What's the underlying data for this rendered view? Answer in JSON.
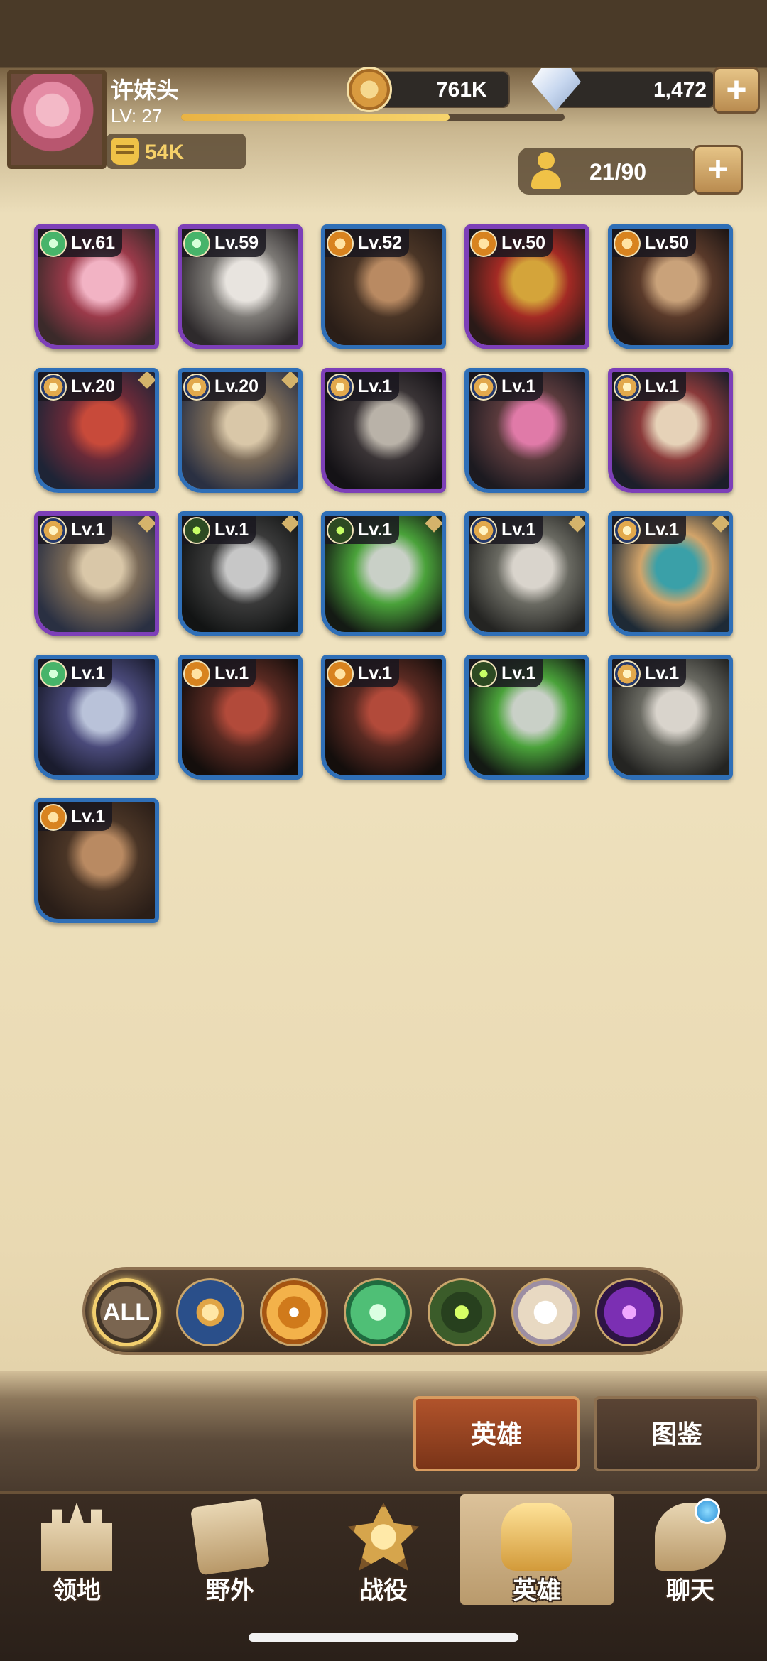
{
  "player": {
    "name": "许妹头",
    "level_label": "LV: 27",
    "xp_progress": 0.7,
    "power": "54K"
  },
  "currency": {
    "gold": "761K",
    "diamonds": "1,472"
  },
  "roster": {
    "count": "21/90"
  },
  "heroes": [
    {
      "level": "Lv.61",
      "faction": "wilder",
      "frame": "purple",
      "colors": [
        "#f2b3c4",
        "#9b3a4a",
        "#3b2a2a"
      ]
    },
    {
      "level": "Lv.59",
      "faction": "wilder",
      "frame": "purple",
      "colors": [
        "#e8e4df",
        "#7d7a76",
        "#2e2a2c"
      ]
    },
    {
      "level": "Lv.52",
      "faction": "mauler",
      "frame": "blue",
      "colors": [
        "#b98a62",
        "#4a3526",
        "#2a1e18"
      ]
    },
    {
      "level": "Lv.50",
      "faction": "mauler",
      "frame": "purple",
      "colors": [
        "#d4a43a",
        "#a32a24",
        "#2a1a18"
      ]
    },
    {
      "level": "Lv.50",
      "faction": "mauler",
      "frame": "blue",
      "colors": [
        "#c9a27a",
        "#5a3a2a",
        "#1e1614"
      ]
    },
    {
      "level": "Lv.20",
      "faction": "lightbearer",
      "frame": "blue",
      "colors": [
        "#c84a3a",
        "#6a2a38",
        "#1e2436"
      ]
    },
    {
      "level": "Lv.20",
      "faction": "lightbearer",
      "frame": "blue",
      "colors": [
        "#d9c7a8",
        "#7a6a58",
        "#2a3042"
      ]
    },
    {
      "level": "Lv.1",
      "faction": "lightbearer",
      "frame": "purple",
      "colors": [
        "#b9b2a8",
        "#3a3436",
        "#141216"
      ]
    },
    {
      "level": "Lv.1",
      "faction": "lightbearer",
      "frame": "blue",
      "colors": [
        "#e07aa8",
        "#5a3a3c",
        "#1c1a20"
      ]
    },
    {
      "level": "Lv.1",
      "faction": "lightbearer",
      "frame": "purple",
      "colors": [
        "#e6d2b8",
        "#8a3a3a",
        "#1c1e2a"
      ]
    },
    {
      "level": "Lv.1",
      "faction": "lightbearer",
      "frame": "purple",
      "colors": [
        "#d9c7a8",
        "#7a6a58",
        "#2a3042"
      ]
    },
    {
      "level": "Lv.1",
      "faction": "graveborn",
      "frame": "blue",
      "colors": [
        "#c7c7c7",
        "#3a3a3a",
        "#121414"
      ]
    },
    {
      "level": "Lv.1",
      "faction": "graveborn",
      "frame": "blue",
      "colors": [
        "#c9d0c7",
        "#4aa23a",
        "#141a14"
      ]
    },
    {
      "level": "Lv.1",
      "faction": "lightbearer",
      "frame": "blue",
      "colors": [
        "#d9d4cc",
        "#6a6a62",
        "#242422"
      ]
    },
    {
      "level": "Lv.1",
      "faction": "lightbearer",
      "frame": "blue",
      "colors": [
        "#3aa0a8",
        "#d2a46a",
        "#1e2a36"
      ]
    },
    {
      "level": "Lv.1",
      "faction": "wilder",
      "frame": "blue",
      "colors": [
        "#b9c2d9",
        "#4a4a7a",
        "#1a1c2e"
      ]
    },
    {
      "level": "Lv.1",
      "faction": "mauler",
      "frame": "blue",
      "colors": [
        "#b24a3a",
        "#5a2a22",
        "#140e0c"
      ]
    },
    {
      "level": "Lv.1",
      "faction": "mauler",
      "frame": "blue",
      "colors": [
        "#b24a3a",
        "#5a2a22",
        "#140e0c"
      ]
    },
    {
      "level": "Lv.1",
      "faction": "graveborn",
      "frame": "blue",
      "colors": [
        "#c9d0c7",
        "#4aa23a",
        "#141a14"
      ]
    },
    {
      "level": "Lv.1",
      "faction": "lightbearer",
      "frame": "blue",
      "colors": [
        "#d9d4cc",
        "#6a6a62",
        "#242422"
      ]
    },
    {
      "level": "Lv.1",
      "faction": "mauler",
      "frame": "blue",
      "colors": [
        "#b98a62",
        "#4a3526",
        "#2a1e18"
      ]
    }
  ],
  "filters": {
    "all_label": "ALL"
  },
  "sub_tabs": {
    "heroes": "英雄",
    "codex": "图鉴"
  },
  "nav": {
    "territory": "领地",
    "wild": "野外",
    "campaign": "战役",
    "heroes": "英雄",
    "chat": "聊天"
  }
}
